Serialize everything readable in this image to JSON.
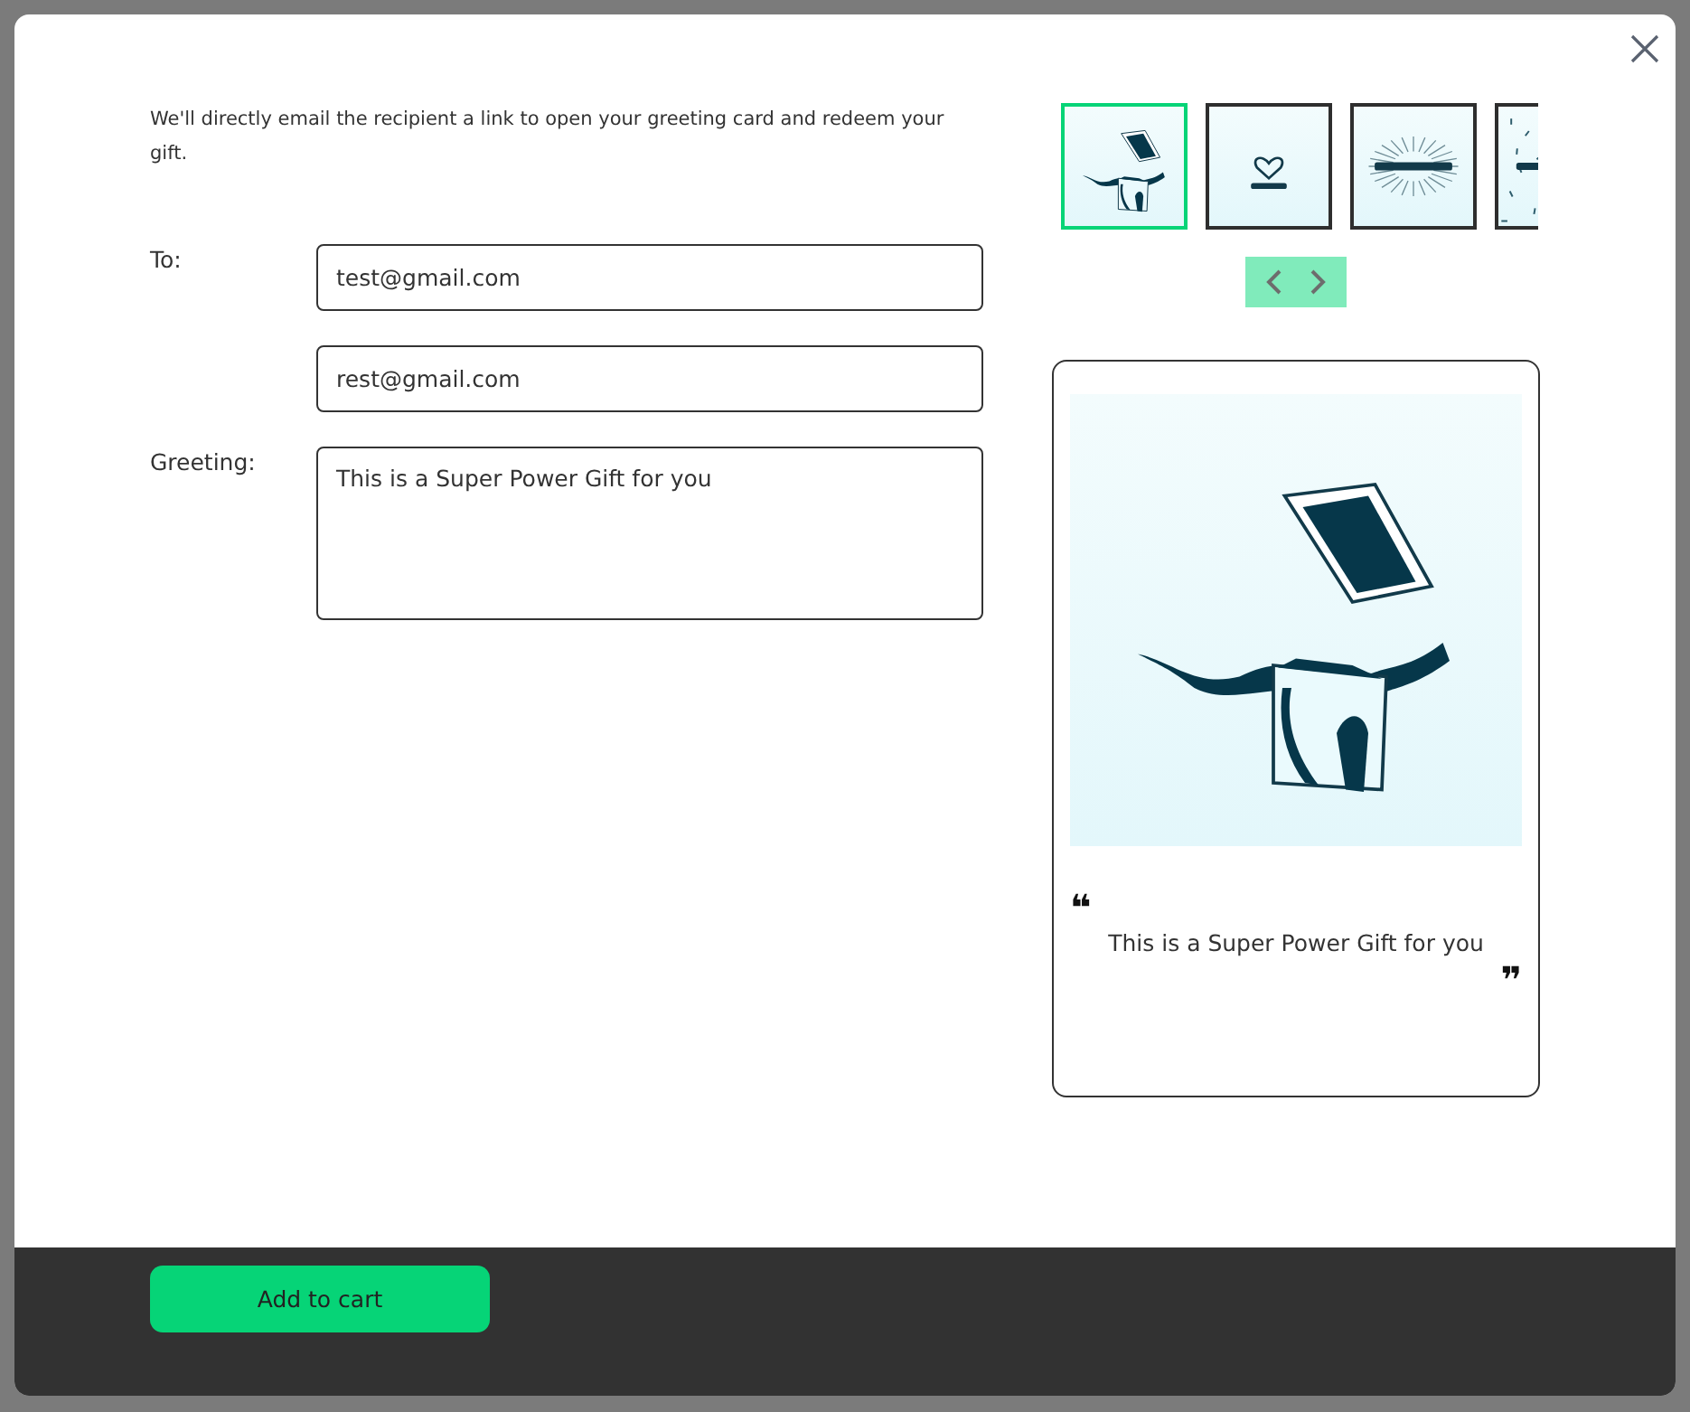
{
  "intro": "We'll directly email the recipient a link to open your greeting card and redeem your gift.",
  "recipients": [
    {
      "label": "To:",
      "value": "test@gmail.com"
    },
    {
      "value": "rest@gmail.com"
    }
  ],
  "greeting": {
    "label": "Greeting:",
    "value": "This is a Super Power Gift for you"
  },
  "designs": [
    {
      "kind": "gift",
      "selected": true
    },
    {
      "kind": "heart",
      "selected": false
    },
    {
      "kind": "rays",
      "selected": false
    },
    {
      "kind": "confetti",
      "selected": false
    }
  ],
  "preview": {
    "open_quote": "❝",
    "message": "This is a Super Power Gift for you",
    "close_quote": "❞"
  },
  "cart_button": "Add to cart"
}
